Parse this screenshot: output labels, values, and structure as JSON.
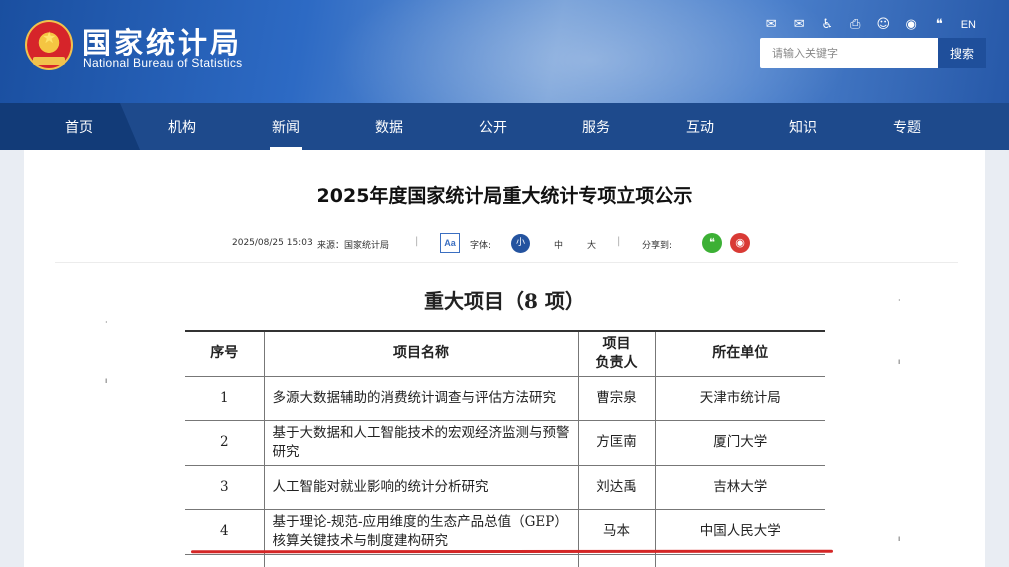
{
  "header": {
    "logo_cn": "国家统计局",
    "logo_en": "National Bureau of Statistics",
    "top_icons": [
      {
        "name": "mail-icon",
        "glyph": "✉"
      },
      {
        "name": "mailbox-icon",
        "glyph": "✉"
      },
      {
        "name": "accessibility-icon",
        "glyph": "♿"
      },
      {
        "name": "print-icon",
        "glyph": "⎙"
      },
      {
        "name": "robot-icon",
        "glyph": "☺"
      },
      {
        "name": "weibo-icon",
        "glyph": "◉"
      },
      {
        "name": "wechat-icon",
        "glyph": "❝"
      }
    ],
    "lang": "EN",
    "search": {
      "placeholder": "请输入关键字",
      "button": "搜索"
    }
  },
  "nav": {
    "items": [
      "首页",
      "机构",
      "新闻",
      "数据",
      "公开",
      "服务",
      "互动",
      "知识",
      "专题"
    ],
    "active": "新闻"
  },
  "article": {
    "title": "2025年度国家统计局重大统计专项立项公示",
    "date": "2025/08/25 15:03",
    "source": "来源：国家统计局",
    "aa": "Aa",
    "font_label": "字体:",
    "font_sizes": [
      "小",
      "中",
      "大"
    ],
    "share_label": "分享到:"
  },
  "document": {
    "heading": "重大项目（8 项）",
    "columns": [
      "序号",
      "项目名称",
      "项目负责人",
      "所在单位"
    ],
    "column_header_lines": {
      "leader": [
        "项目",
        "负责人"
      ]
    },
    "rows": [
      {
        "no": "1",
        "name": "多源大数据辅助的消费统计调查与评估方法研究",
        "leader": "曹宗泉",
        "unit": "天津市统计局"
      },
      {
        "no": "2",
        "name": "基于大数据和人工智能技术的宏观经济监测与预警研究",
        "leader": "方匡南",
        "unit": "厦门大学"
      },
      {
        "no": "3",
        "name": "人工智能对就业影响的统计分析研究",
        "leader": "刘达禹",
        "unit": "吉林大学"
      },
      {
        "no": "4",
        "name": "基于理论-规范-应用维度的生态产品总值（GEP）核算关键技术与制度建构研究",
        "leader": "马本",
        "unit": "中国人民大学"
      }
    ]
  },
  "colors": {
    "nav_bg": "#1e4a8c",
    "accent": "#24539f",
    "underline": "#d42626",
    "wechat": "#3cb035",
    "weibo": "#d93a35"
  }
}
